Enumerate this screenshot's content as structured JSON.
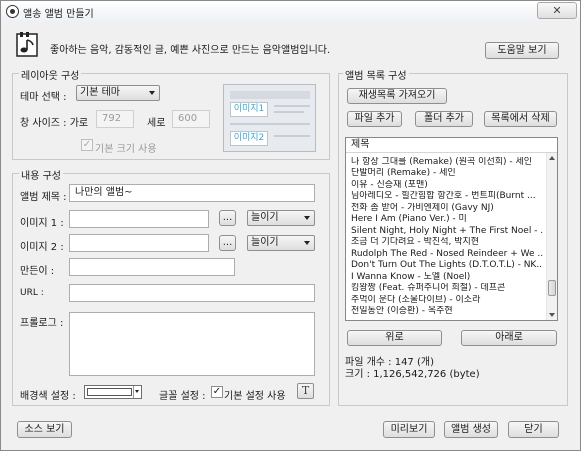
{
  "window": {
    "title": "앨송 앨범 만들기",
    "close_label": "✕"
  },
  "header": {
    "description": "좋아하는 음악, 감동적인 글, 예쁜 사진으로 만드는 음악앨범입니다.",
    "help_button": "도움말 보기"
  },
  "layout_section": {
    "title": "레이아웃 구성",
    "theme_label": "테마 선택 :",
    "theme_value": "기본 테마",
    "window_size_label": "창 사이즈 : 가로",
    "width_value": "792",
    "height_label": "세로",
    "height_value": "600",
    "default_size_label": "기본 크기 사용",
    "preview": {
      "image1": "이미지1",
      "image2": "이미지2"
    }
  },
  "content_section": {
    "title": "내용 구성",
    "album_title_label": "앨범 제목 :",
    "album_title_value": "나만의 앨범~",
    "image1_label": "이미지 1 :",
    "image1_value": "",
    "image1_mode": "늘이기",
    "image2_label": "이미지 2 :",
    "image2_value": "",
    "image2_mode": "늘이기",
    "browse_label": "...",
    "maker_label": "만든이 :",
    "maker_value": "",
    "url_label": "URL :",
    "url_value": "",
    "prologue_label": "프롤로그 :",
    "bgcolor_label": "배경색 설정 :",
    "font_label": "글꼴 설정 :",
    "font_default_label": "기본 설정 사용",
    "font_icon_glyph": "T"
  },
  "album_list": {
    "title": "앨범 목록 구성",
    "load_playlist": "재생목록 가져오기",
    "add_file": "파일 추가",
    "add_folder": "폴더 추가",
    "remove": "목록에서 삭제",
    "column_header": "제목",
    "items": [
      "나 항상 그대를 (Remake) (원곡 이선희) - 세인",
      "단발머리 (Remake) - 세인",
      "이유 - 신승재 (포맨)",
      "님아레디오 - 힐간힘합 항간호 - 번트피(Burnt ...",
      "전화 좀 받어 - 가비엔제이 (Gavy NJ)",
      "Here I Am (Piano Ver.) - 미",
      "Silent Night, Holy Night + The First Noel - ...",
      "조금 더 기다려요 - 박진석, 박지현",
      "Rudolph The Red - Nosed Reindeer + We ...",
      "Don't Turn Out The Lights (D.T.O.T.L) - NK...",
      "I Wanna Know - 노엘 (Noel)",
      "킹왕짱 (Feat. 슈퍼주니어 희철) - 데프콘",
      "주먹이 운다 (소울다이브) - 이소라",
      "천일동안 (이승환) - 옥주현"
    ],
    "up_button": "위로",
    "down_button": "아래로",
    "file_count": "파일 개수 : 147 (개)",
    "size": "크기 : 1,126,542,726 (byte)"
  },
  "footer": {
    "view_source": "소스 보기",
    "preview": "미리보기",
    "create": "앨범 생성",
    "close": "닫기"
  }
}
